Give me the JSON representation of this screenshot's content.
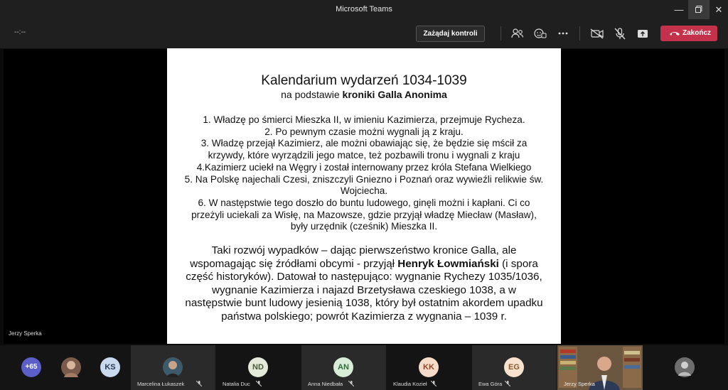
{
  "window": {
    "title": "Microsoft Teams"
  },
  "toolbar": {
    "timer": "--:--",
    "control_label": "Zażądaj kontroli",
    "end_label": "Zakończ",
    "icons": [
      "participants-icon",
      "reactions-icon",
      "more-icon",
      "camera-off-icon",
      "mic-off-icon",
      "share-icon",
      "phone-icon"
    ]
  },
  "slide": {
    "title": "Kalendarium wydarzeń 1034-1039",
    "subtitle_prefix": "na podstawie ",
    "subtitle_bold": "kroniki Galla Anonima",
    "items": [
      "1. Władzę po śmierci Mieszka II, w imieniu Kazimierza, przejmuje Rycheza.",
      "2. Po pewnym czasie możni wygnali ją z kraju.",
      "3. Władzę przejął Kazimierz, ale możni obawiając się, że będzie się mścił za krzywdy, które wyrządzili jego matce, też pozbawili tronu i wygnali z kraju",
      "4.Kazimierz uciekł na Węgry i został internowany przez króla Stefana Wielkiego",
      "5. Na Polskę najechali Czesi, zniszczyli Gniezno i Poznań oraz wywieźli relikwie św. Wojciecha.",
      "6. W następstwie tego doszło do buntu ludowego, ginęli możni i kapłani. Ci co przeżyli uciekali za Wisłę, na Mazowsze, gdzie przyjął władzę Miecław (Masław), były urzędnik (cześnik) Mieszka II."
    ],
    "para_before": "Taki rozwój wypadków – dając pierwszeństwo kronice Galla, ale wspomagając się źródłami obcymi - przyjął ",
    "para_bold": "Henryk Łowmiański",
    "para_after": " (i spora część historyków). Datował to następująco: wygnanie Rychezy 1035/1036, wygnanie Kazimierza i najazd Brzetysława czeskiego 1038, a w następstwie bunt ludowy jesienią 1038, który był ostatnim akordem upadku państwa polskiego; powrót Kazimierza z wygnania – 1039 r."
  },
  "presenter": {
    "name": "Jerzy Sperka"
  },
  "participants": {
    "overflow": "+65",
    "ks_initials": "KS",
    "tiles": [
      {
        "name": "Marcelina Łukaszek",
        "initials": "",
        "color": "#3d5a6b"
      },
      {
        "name": "Natalia Duc",
        "initials": "ND",
        "color": "#e3ead9"
      },
      {
        "name": "Anna Niedbała",
        "initials": "AN",
        "color": "#d8ecd8"
      },
      {
        "name": "Klaudia Kozieł",
        "initials": "KK",
        "color": "#f6dcc8"
      },
      {
        "name": "Ewa Góra",
        "initials": "EG",
        "color": "#f6e2cf"
      },
      {
        "name": "Jerzy Sperka",
        "initials": "",
        "color": "#6b5a44"
      }
    ]
  },
  "colors": {
    "end_button": "#c4314b",
    "overflow_badge": "#5b5fc7"
  }
}
